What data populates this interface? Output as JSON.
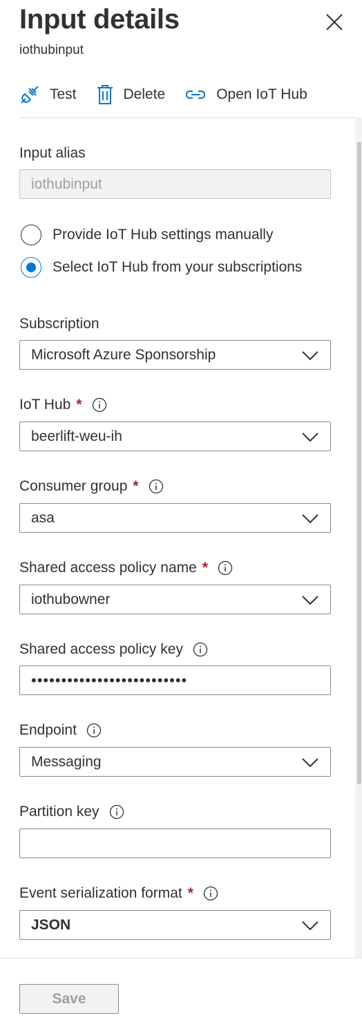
{
  "header": {
    "title": "Input details",
    "subtitle": "iothubinput"
  },
  "toolbar": {
    "test_label": "Test",
    "delete_label": "Delete",
    "open_label": "Open IoT Hub"
  },
  "form": {
    "input_alias": {
      "label": "Input alias",
      "value": "iothubinput"
    },
    "radio_manual": {
      "label": "Provide IoT Hub settings manually",
      "selected": false
    },
    "radio_subscription": {
      "label": "Select IoT Hub from your subscriptions",
      "selected": true
    },
    "subscription": {
      "label": "Subscription",
      "value": "Microsoft Azure Sponsorship"
    },
    "iot_hub": {
      "label": "IoT Hub",
      "required": "*",
      "value": "beerlift-weu-ih"
    },
    "consumer_group": {
      "label": "Consumer group",
      "required": "*",
      "value": "asa"
    },
    "policy_name": {
      "label": "Shared access policy name",
      "required": "*",
      "value": "iothubowner"
    },
    "policy_key": {
      "label": "Shared access policy key",
      "value": "••••••••••••••••••••••••••"
    },
    "endpoint": {
      "label": "Endpoint",
      "value": "Messaging"
    },
    "partition_key": {
      "label": "Partition key",
      "value": ""
    },
    "serialization": {
      "label": "Event serialization format",
      "required": "*",
      "value": "JSON"
    }
  },
  "footer": {
    "save_label": "Save"
  },
  "colors": {
    "accent": "#0078d4",
    "required": "#a4262c",
    "text": "#323130",
    "border": "#8a8886"
  }
}
